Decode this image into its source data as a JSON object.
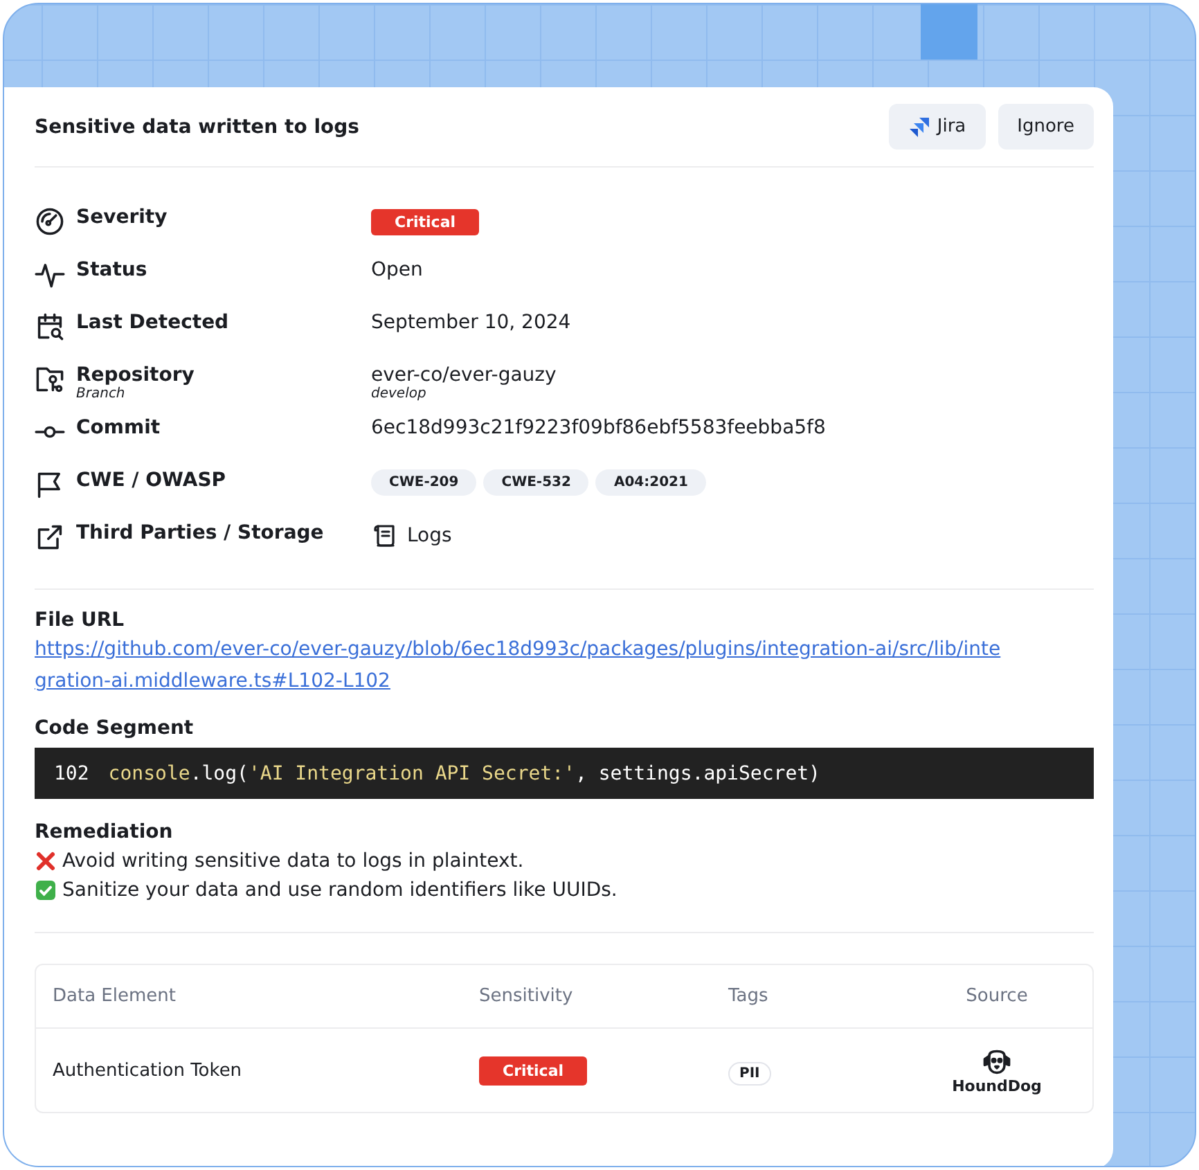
{
  "header": {
    "title": "Sensitive data written to logs",
    "buttons": [
      {
        "label": "Jira",
        "kind": "jira"
      },
      {
        "label": "Ignore",
        "kind": "plain"
      }
    ]
  },
  "details": [
    {
      "kind": "badge",
      "label": "Severity",
      "value": "Critical"
    },
    {
      "kind": "text",
      "label": "Status",
      "value": "Open"
    },
    {
      "kind": "text",
      "label": "Last Detected",
      "value": "September 10, 2024"
    },
    {
      "kind": "text",
      "label": "Repository",
      "sublabel": "Branch",
      "value": "ever-co/ever-gauzy",
      "subvalue": "develop"
    },
    {
      "kind": "text",
      "label": "Commit",
      "value": "6ec18d993c21f9223f09bf86ebf5583feebba5f8"
    },
    {
      "kind": "chips",
      "label": "CWE / OWASP",
      "values": [
        "CWE-209",
        "CWE-532",
        "A04:2021"
      ]
    },
    {
      "kind": "storage",
      "label": "Third Parties / Storage",
      "value": "Logs"
    }
  ],
  "file_url": {
    "label": "File URL",
    "url": "https://github.com/ever-co/ever-gauzy/blob/6ec18d993c/packages/plugins/integration-ai/src/lib/integration-ai.middleware.ts#L102-L102"
  },
  "code_segment": {
    "label": "Code Segment",
    "line_number": "102",
    "tokens": [
      {
        "kind": "identifier",
        "text": "console"
      },
      {
        "kind": "plain",
        "text": ".log("
      },
      {
        "kind": "string",
        "text": "'AI Integration API Secret:'"
      },
      {
        "kind": "plain",
        "text": ", settings.apiSecret)"
      }
    ]
  },
  "remediation": {
    "label": "Remediation",
    "items": [
      {
        "kind": "dont",
        "text": "Avoid writing sensitive data to logs in plaintext."
      },
      {
        "kind": "do",
        "text": "Sanitize your data and use random identifiers like UUIDs."
      }
    ]
  },
  "table": {
    "columns": [
      "Data Element",
      "Sensitivity",
      "Tags",
      "Source"
    ],
    "rows": [
      {
        "data_element": "Authentication Token",
        "sensitivity": "Critical",
        "tags": [
          "PII"
        ],
        "source": "HoundDog"
      }
    ]
  }
}
